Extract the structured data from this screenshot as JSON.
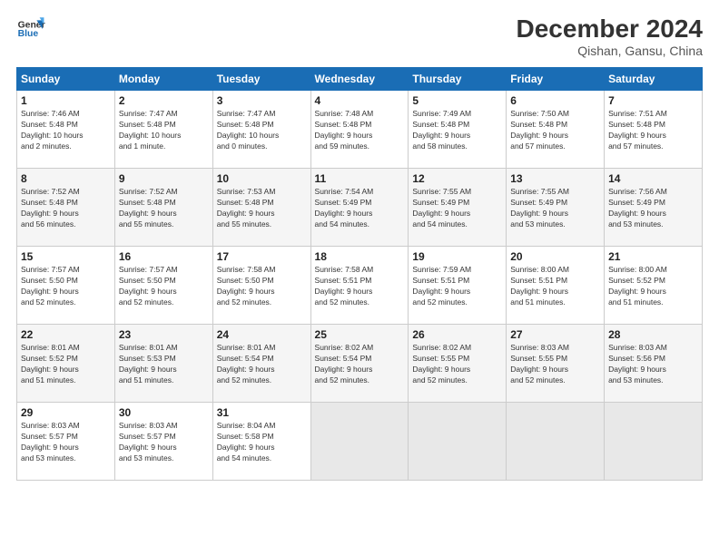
{
  "logo": {
    "line1": "General",
    "line2": "Blue"
  },
  "header": {
    "month": "December 2024",
    "location": "Qishan, Gansu, China"
  },
  "weekdays": [
    "Sunday",
    "Monday",
    "Tuesday",
    "Wednesday",
    "Thursday",
    "Friday",
    "Saturday"
  ],
  "weeks": [
    [
      {
        "day": "1",
        "info": "Sunrise: 7:46 AM\nSunset: 5:48 PM\nDaylight: 10 hours\nand 2 minutes."
      },
      {
        "day": "2",
        "info": "Sunrise: 7:47 AM\nSunset: 5:48 PM\nDaylight: 10 hours\nand 1 minute."
      },
      {
        "day": "3",
        "info": "Sunrise: 7:47 AM\nSunset: 5:48 PM\nDaylight: 10 hours\nand 0 minutes."
      },
      {
        "day": "4",
        "info": "Sunrise: 7:48 AM\nSunset: 5:48 PM\nDaylight: 9 hours\nand 59 minutes."
      },
      {
        "day": "5",
        "info": "Sunrise: 7:49 AM\nSunset: 5:48 PM\nDaylight: 9 hours\nand 58 minutes."
      },
      {
        "day": "6",
        "info": "Sunrise: 7:50 AM\nSunset: 5:48 PM\nDaylight: 9 hours\nand 57 minutes."
      },
      {
        "day": "7",
        "info": "Sunrise: 7:51 AM\nSunset: 5:48 PM\nDaylight: 9 hours\nand 57 minutes."
      }
    ],
    [
      {
        "day": "8",
        "info": "Sunrise: 7:52 AM\nSunset: 5:48 PM\nDaylight: 9 hours\nand 56 minutes."
      },
      {
        "day": "9",
        "info": "Sunrise: 7:52 AM\nSunset: 5:48 PM\nDaylight: 9 hours\nand 55 minutes."
      },
      {
        "day": "10",
        "info": "Sunrise: 7:53 AM\nSunset: 5:48 PM\nDaylight: 9 hours\nand 55 minutes."
      },
      {
        "day": "11",
        "info": "Sunrise: 7:54 AM\nSunset: 5:49 PM\nDaylight: 9 hours\nand 54 minutes."
      },
      {
        "day": "12",
        "info": "Sunrise: 7:55 AM\nSunset: 5:49 PM\nDaylight: 9 hours\nand 54 minutes."
      },
      {
        "day": "13",
        "info": "Sunrise: 7:55 AM\nSunset: 5:49 PM\nDaylight: 9 hours\nand 53 minutes."
      },
      {
        "day": "14",
        "info": "Sunrise: 7:56 AM\nSunset: 5:49 PM\nDaylight: 9 hours\nand 53 minutes."
      }
    ],
    [
      {
        "day": "15",
        "info": "Sunrise: 7:57 AM\nSunset: 5:50 PM\nDaylight: 9 hours\nand 52 minutes."
      },
      {
        "day": "16",
        "info": "Sunrise: 7:57 AM\nSunset: 5:50 PM\nDaylight: 9 hours\nand 52 minutes."
      },
      {
        "day": "17",
        "info": "Sunrise: 7:58 AM\nSunset: 5:50 PM\nDaylight: 9 hours\nand 52 minutes."
      },
      {
        "day": "18",
        "info": "Sunrise: 7:58 AM\nSunset: 5:51 PM\nDaylight: 9 hours\nand 52 minutes."
      },
      {
        "day": "19",
        "info": "Sunrise: 7:59 AM\nSunset: 5:51 PM\nDaylight: 9 hours\nand 52 minutes."
      },
      {
        "day": "20",
        "info": "Sunrise: 8:00 AM\nSunset: 5:51 PM\nDaylight: 9 hours\nand 51 minutes."
      },
      {
        "day": "21",
        "info": "Sunrise: 8:00 AM\nSunset: 5:52 PM\nDaylight: 9 hours\nand 51 minutes."
      }
    ],
    [
      {
        "day": "22",
        "info": "Sunrise: 8:01 AM\nSunset: 5:52 PM\nDaylight: 9 hours\nand 51 minutes."
      },
      {
        "day": "23",
        "info": "Sunrise: 8:01 AM\nSunset: 5:53 PM\nDaylight: 9 hours\nand 51 minutes."
      },
      {
        "day": "24",
        "info": "Sunrise: 8:01 AM\nSunset: 5:54 PM\nDaylight: 9 hours\nand 52 minutes."
      },
      {
        "day": "25",
        "info": "Sunrise: 8:02 AM\nSunset: 5:54 PM\nDaylight: 9 hours\nand 52 minutes."
      },
      {
        "day": "26",
        "info": "Sunrise: 8:02 AM\nSunset: 5:55 PM\nDaylight: 9 hours\nand 52 minutes."
      },
      {
        "day": "27",
        "info": "Sunrise: 8:03 AM\nSunset: 5:55 PM\nDaylight: 9 hours\nand 52 minutes."
      },
      {
        "day": "28",
        "info": "Sunrise: 8:03 AM\nSunset: 5:56 PM\nDaylight: 9 hours\nand 53 minutes."
      }
    ],
    [
      {
        "day": "29",
        "info": "Sunrise: 8:03 AM\nSunset: 5:57 PM\nDaylight: 9 hours\nand 53 minutes."
      },
      {
        "day": "30",
        "info": "Sunrise: 8:03 AM\nSunset: 5:57 PM\nDaylight: 9 hours\nand 53 minutes."
      },
      {
        "day": "31",
        "info": "Sunrise: 8:04 AM\nSunset: 5:58 PM\nDaylight: 9 hours\nand 54 minutes."
      },
      {
        "day": "",
        "info": ""
      },
      {
        "day": "",
        "info": ""
      },
      {
        "day": "",
        "info": ""
      },
      {
        "day": "",
        "info": ""
      }
    ]
  ]
}
